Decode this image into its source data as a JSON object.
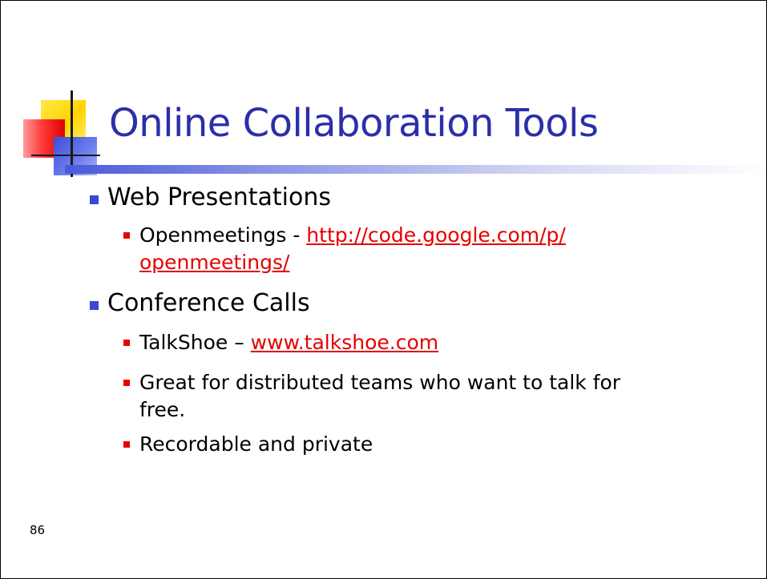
{
  "slide": {
    "title": "Online Collaboration Tools",
    "page_number": "86",
    "bullets": [
      {
        "text": "Web Presentations",
        "sub": [
          {
            "prefix": "Openmeetings - ",
            "link_line1": "http://code.google.com/p/",
            "link_line2": "openmeetings/"
          }
        ]
      },
      {
        "text": "Conference Calls",
        "sub": [
          {
            "prefix": "TalkShoe – ",
            "link": "www.talkshoe.com"
          },
          {
            "line1": "Great for distributed teams who want to talk for",
            "line2": "free."
          },
          {
            "text": "Recordable and private"
          }
        ]
      }
    ]
  },
  "colors": {
    "title": "#2b2fa8",
    "level1_bullet": "#3b48d0",
    "level2_bullet": "#e60000",
    "link": "#e60000"
  }
}
